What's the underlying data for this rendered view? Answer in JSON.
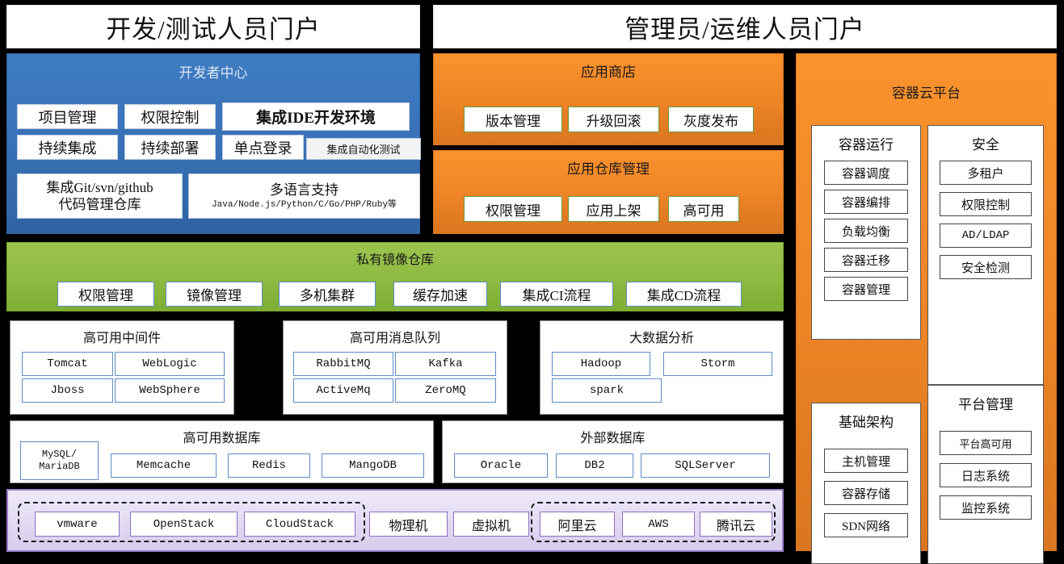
{
  "theme": {
    "background": "#000000",
    "blue": "#3a72b8",
    "orange": "#ef8526",
    "green": "#8fbb43",
    "purple_fill": "#e0d8f1",
    "purple_border": "#9a7fc9",
    "box_blue_border": "#5b8bc4",
    "box_green_border": "#6f9a3c"
  },
  "portals": {
    "left_title": "开发/测试人员门户",
    "right_title": "管理员/运维人员门户"
  },
  "developer_center": {
    "title": "开发者中心",
    "row1": [
      {
        "label": "项目管理",
        "bold": false
      },
      {
        "label": "权限控制",
        "bold": false
      },
      {
        "label": "集成IDE开发环境",
        "bold": true
      }
    ],
    "row2": [
      {
        "label": "持续集成",
        "bold": false
      },
      {
        "label": "持续部署",
        "bold": false
      },
      {
        "label": "单点登录",
        "bold": false
      },
      {
        "label": "集成自动化测试",
        "bold": false
      }
    ],
    "row3": [
      {
        "line1": "集成Git/svn/github",
        "line2": "代码管理仓库"
      },
      {
        "line1": "多语言支持",
        "line2": "Java/Node.js/Python/C/Go/PHP/Ruby等"
      }
    ]
  },
  "app_store": {
    "title": "应用商店",
    "items": [
      "版本管理",
      "升级回滚",
      "灰度发布"
    ]
  },
  "app_repo": {
    "title": "应用仓库管理",
    "items": [
      "权限管理",
      "应用上架",
      "高可用"
    ]
  },
  "container_cloud": {
    "title": "容器云平台",
    "groups": [
      {
        "title": "容器运行",
        "items": [
          "容器调度",
          "容器编排",
          "负载均衡",
          "容器迁移",
          "容器管理"
        ]
      },
      {
        "title": "安全",
        "items": [
          "多租户",
          "权限控制",
          "AD/LDAP",
          "安全检测"
        ]
      },
      {
        "title": "基础架构",
        "items": [
          "主机管理",
          "容器存储",
          "SDN网络"
        ]
      },
      {
        "title": "平台管理",
        "items": [
          "平台高可用",
          "日志系统",
          "监控系统"
        ]
      }
    ]
  },
  "private_registry": {
    "title": "私有镜像仓库",
    "items": [
      "权限管理",
      "镜像管理",
      "多机集群",
      "缓存加速",
      "集成CI流程",
      "集成CD流程"
    ]
  },
  "middleware": {
    "title": "高可用中间件",
    "items": [
      "Tomcat",
      "WebLogic",
      "Jboss",
      "WebSphere"
    ]
  },
  "message_queue": {
    "title": "高可用消息队列",
    "items": [
      "RabbitMQ",
      "Kafka",
      "ActiveMq",
      "ZeroMQ"
    ]
  },
  "big_data": {
    "title": "大数据分析",
    "items": [
      "Hadoop",
      "Storm",
      "spark"
    ]
  },
  "ha_database": {
    "title": "高可用数据库",
    "first_item": {
      "line1": "MySQL/",
      "line2": "MariaDB"
    },
    "items": [
      "Memcache",
      "Redis",
      "MangoDB"
    ]
  },
  "external_database": {
    "title": "外部数据库",
    "items": [
      "Oracle",
      "DB2",
      "SQLServer"
    ]
  },
  "infrastructure": {
    "virtualization_group": [
      "vmware",
      "OpenStack",
      "CloudStack"
    ],
    "standalone": [
      "物理机",
      "虚拟机"
    ],
    "cloud_group": [
      "阿里云",
      "AWS",
      "腾讯云"
    ]
  }
}
